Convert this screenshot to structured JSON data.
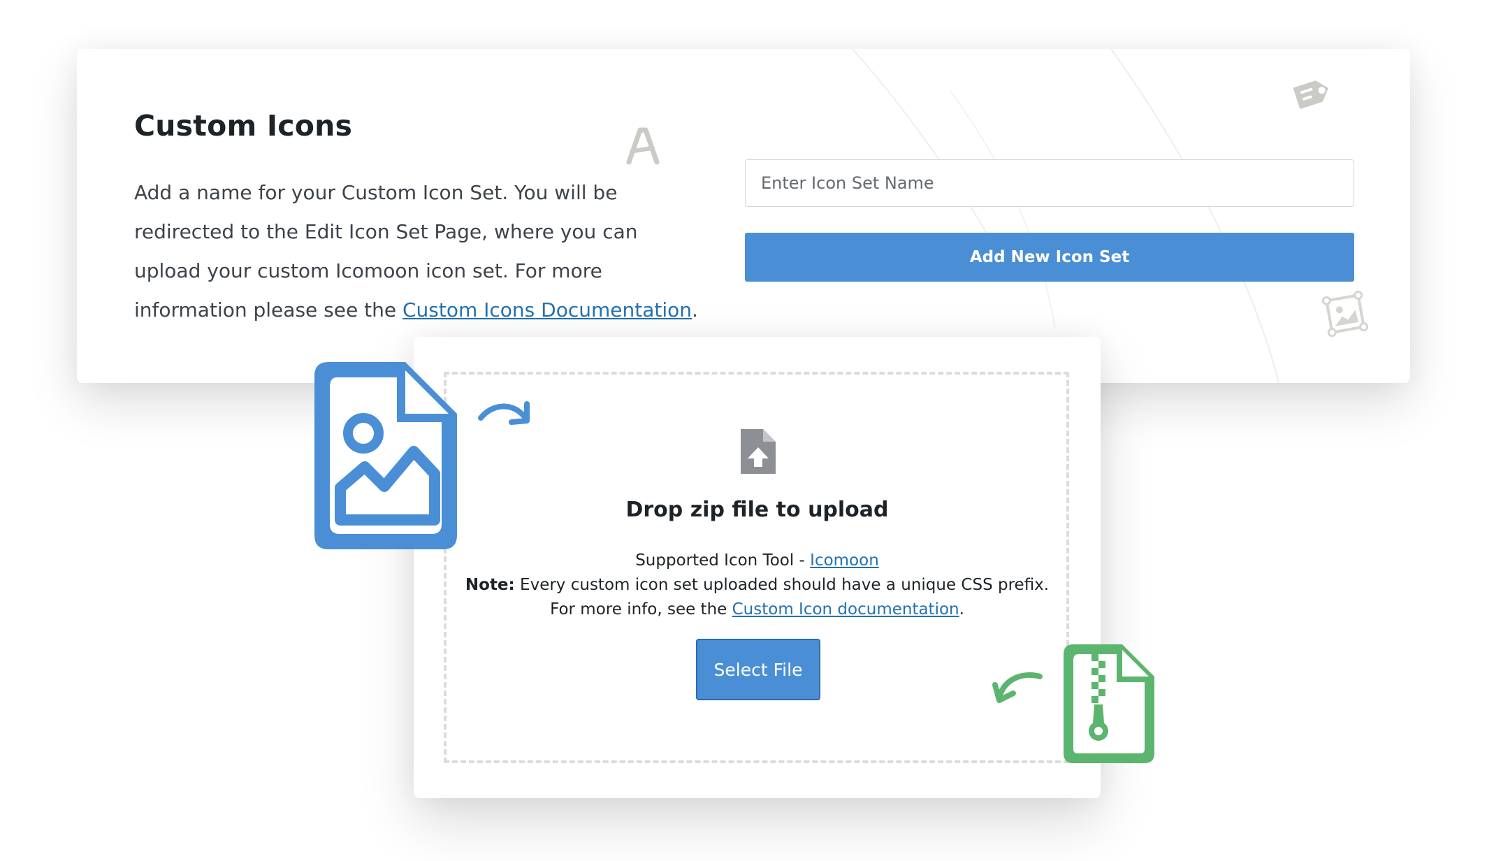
{
  "custom_icons": {
    "title": "Custom Icons",
    "description": "Add a name for your Custom Icon Set. You will be redirected to the Edit Icon Set Page, where you can upload your custom Icomoon icon set. For more information please see the",
    "doc_link_label": "Custom Icons Documentation",
    "description_end": ".",
    "icon_set_name_placeholder": "Enter Icon Set Name",
    "icon_set_name_value": "",
    "add_button_label": "Add New Icon Set"
  },
  "upload": {
    "title": "Drop zip file to upload",
    "supported_prefix": "Supported Icon Tool - ",
    "supported_tool_link": "Icomoon",
    "note_label": "Note:",
    "note_text": " Every custom icon set uploaded should have a unique CSS prefix. For more info, see the ",
    "note_link_label": "Custom Icon documentation",
    "note_end": ".",
    "select_button_label": "Select File"
  },
  "colors": {
    "accent_blue": "#4a8fd6",
    "link_blue": "#2271b1",
    "zip_green": "#5cb56e",
    "upload_icon_gray": "#8c8f94",
    "decor_gray": "#c9cbc4"
  },
  "icons": {
    "image_file": "image-file-icon",
    "zip_file": "zip-file-icon",
    "file_upload": "file-upload-icon",
    "curved_arrow_right": "curved-arrow-right-icon",
    "curved_arrow_left": "curved-arrow-left-icon",
    "letter_a": "letter-a-icon",
    "price_tag": "tag-icon",
    "picture_frame": "picture-frame-icon"
  }
}
